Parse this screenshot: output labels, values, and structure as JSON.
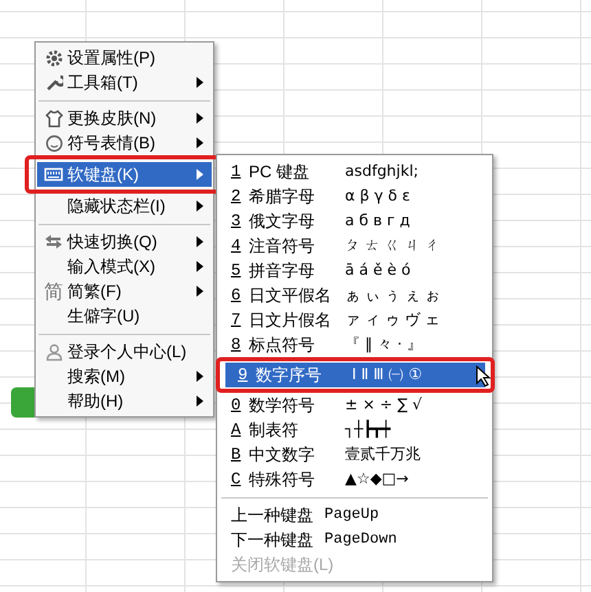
{
  "main_menu": [
    {
      "label": "设置属性(P)",
      "submenu": false,
      "selected": false
    },
    {
      "label": "工具箱(T)",
      "submenu": true,
      "selected": false,
      "separator_after": true
    },
    {
      "label": "更换皮肤(N)",
      "submenu": true,
      "selected": false
    },
    {
      "label": "符号表情(B)",
      "submenu": true,
      "selected": false
    },
    {
      "label": "软键盘(K)",
      "submenu": true,
      "selected": true
    },
    {
      "label": "隐藏状态栏(I)",
      "submenu": true,
      "selected": false,
      "separator_after": true
    },
    {
      "label": "快速切换(Q)",
      "submenu": true,
      "selected": false
    },
    {
      "label": "输入模式(X)",
      "submenu": true,
      "selected": false
    },
    {
      "label": "简繁(F)",
      "icon_text": "简",
      "submenu": true,
      "selected": false
    },
    {
      "label": "生僻字(U)",
      "submenu": false,
      "selected": false,
      "separator_after": true
    },
    {
      "label": "登录个人中心(L)",
      "submenu": false,
      "selected": false
    },
    {
      "label": "搜索(M)",
      "submenu": true,
      "selected": false
    },
    {
      "label": "帮助(H)",
      "submenu": true,
      "selected": false
    }
  ],
  "keyboard_menu": [
    {
      "key": "1",
      "label": "PC 键盘",
      "sample": "asdfghjkl;",
      "selected": false
    },
    {
      "key": "2",
      "label": "希腊字母",
      "sample": "α β γ δ ε",
      "selected": false
    },
    {
      "key": "3",
      "label": "俄文字母",
      "sample": "а б в г д",
      "selected": false
    },
    {
      "key": "4",
      "label": "注音符号",
      "sample": "ㄆ ㄊ ㄍ ㄐ ㄔ",
      "selected": false
    },
    {
      "key": "5",
      "label": "拼音字母",
      "sample": "ā á ě è ó",
      "selected": false
    },
    {
      "key": "6",
      "label": "日文平假名",
      "sample": "ぁ ぃ ぅ ぇ ぉ",
      "selected": false
    },
    {
      "key": "7",
      "label": "日文片假名",
      "sample": "ァ ィ ゥ ヴ ェ",
      "selected": false
    },
    {
      "key": "8",
      "label": "标点符号",
      "sample": "『 ‖ 々 · 』",
      "selected": false
    },
    {
      "key": "9",
      "label": "数字序号",
      "sample": "Ⅰ Ⅱ Ⅲ ㈠ ①",
      "selected": true
    },
    {
      "key": "0",
      "label": "数学符号",
      "sample": "± × ÷ ∑ √",
      "selected": false
    },
    {
      "key": "A",
      "label": "制表符",
      "sample": "┐┼┣┳┿",
      "selected": false
    },
    {
      "key": "B",
      "label": "中文数字",
      "sample": "壹贰千万兆",
      "selected": false
    },
    {
      "key": "C",
      "label": "特殊符号",
      "sample": "▲☆◆□→",
      "selected": false,
      "separator_after": true
    },
    {
      "label": "上一种键盘",
      "sample": "PageUp",
      "disabled": false
    },
    {
      "label": "下一种键盘",
      "sample": "PageDown",
      "disabled": false
    },
    {
      "label": "关闭软键盘(L)",
      "disabled": true
    }
  ]
}
